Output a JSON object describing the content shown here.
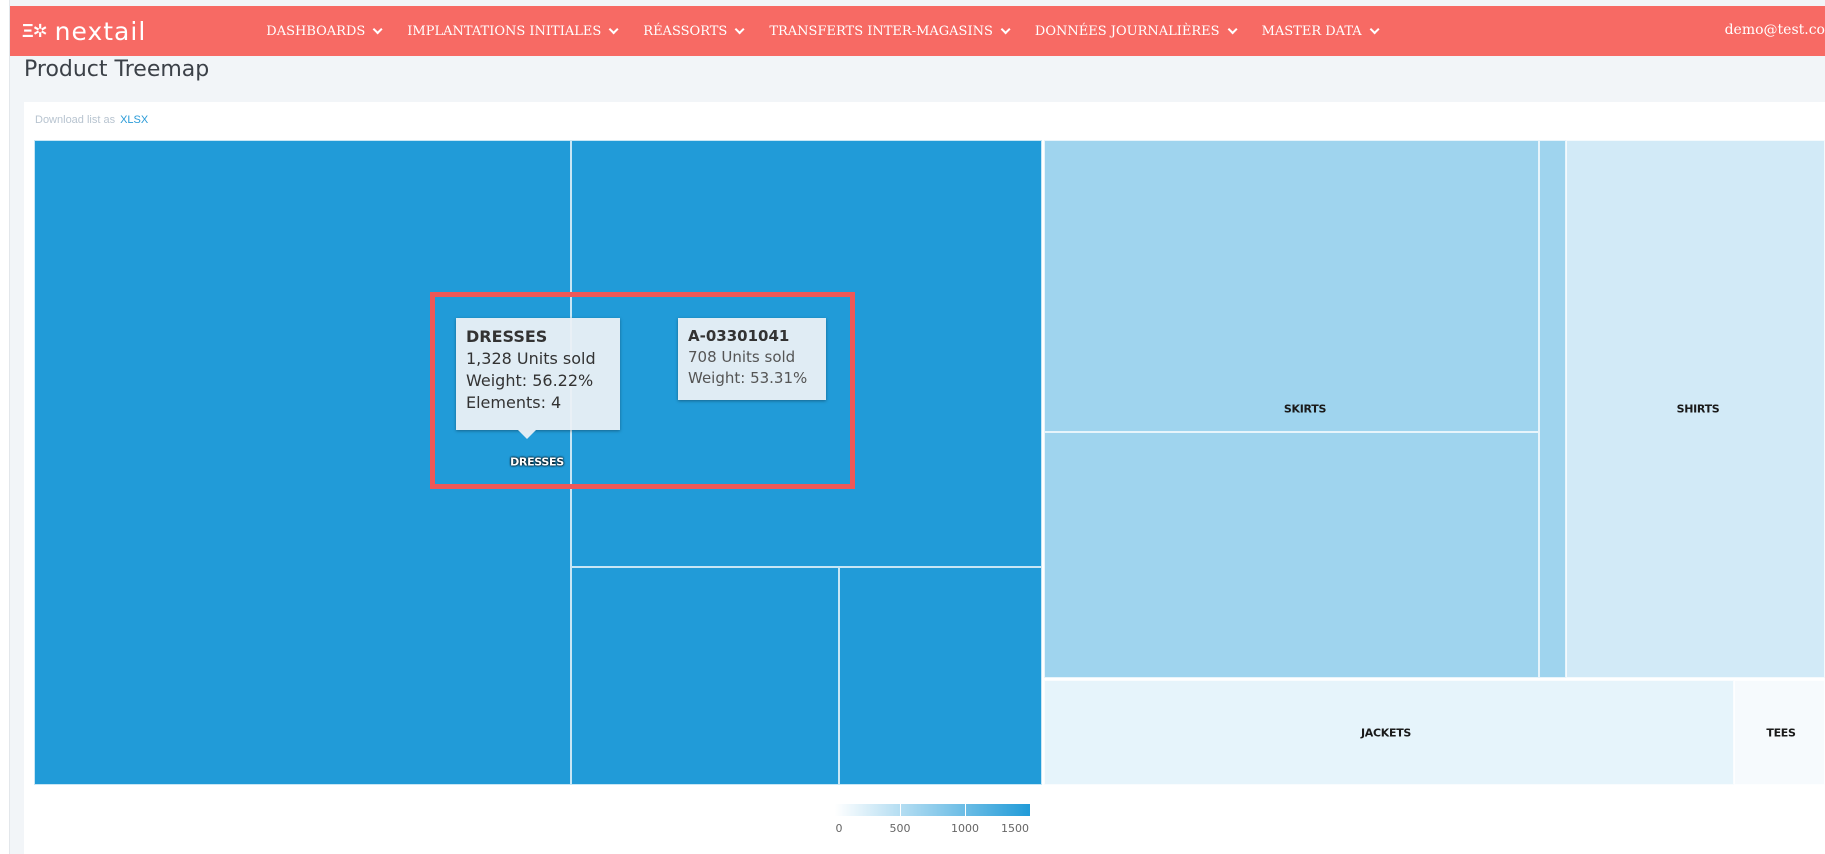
{
  "header": {
    "logo_mark": "Ξ✲",
    "logo_text": "nextail",
    "nav": [
      {
        "label": "DASHBOARDS"
      },
      {
        "label": "IMPLANTATIONS INITIALES"
      },
      {
        "label": "RÉASSORTS"
      },
      {
        "label": "TRANSFERTS INTER-MAGASINS"
      },
      {
        "label": "DONNÉES JOURNALIÈRES"
      },
      {
        "label": "MASTER DATA"
      }
    ],
    "user": "demo@test.co"
  },
  "page": {
    "title": "Product Treemap",
    "download_prefix": "Download list as",
    "download_link": "XLSX"
  },
  "treemap": {
    "labels": {
      "dresses": "DRESSES",
      "skirts": "SKIRTS",
      "shirts": "SHIRTS",
      "jackets": "JACKETS",
      "tees": "TEES"
    },
    "tooltip_category": {
      "title": "DRESSES",
      "line1": "1,328 Units sold",
      "line2": "Weight: 56.22%",
      "line3": "Elements: 4"
    },
    "tooltip_item": {
      "title": "A-03301041",
      "line1": "708 Units sold",
      "line2": "Weight: 53.31%"
    }
  },
  "legend": {
    "ticks": [
      "0",
      "500",
      "1000",
      "1500"
    ]
  },
  "colors": {
    "topbar": "#f76a64",
    "accent": "#219bd8",
    "highlight": "#ef5757"
  }
}
